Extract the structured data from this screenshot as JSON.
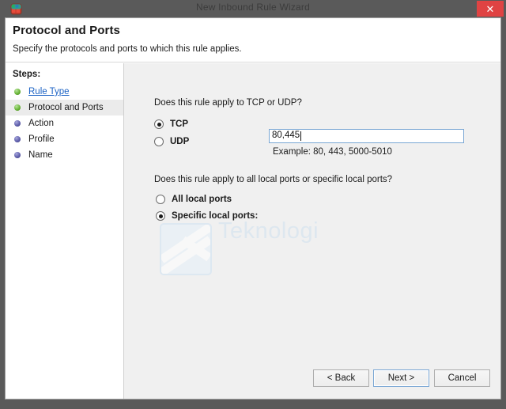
{
  "window": {
    "title": "New Inbound Rule Wizard",
    "icon": "firewall-shield-icon",
    "close_label": "✕"
  },
  "header": {
    "title": "Protocol and Ports",
    "subtitle": "Specify the protocols and ports to which this rule applies."
  },
  "sidebar": {
    "steps_label": "Steps:",
    "items": [
      {
        "label": "Rule Type",
        "state": "done",
        "is_link": true,
        "current": false
      },
      {
        "label": "Protocol and Ports",
        "state": "done",
        "is_link": false,
        "current": true
      },
      {
        "label": "Action",
        "state": "todo",
        "is_link": false,
        "current": false
      },
      {
        "label": "Profile",
        "state": "todo",
        "is_link": false,
        "current": false
      },
      {
        "label": "Name",
        "state": "todo",
        "is_link": false,
        "current": false
      }
    ]
  },
  "content": {
    "question_protocol": "Does this rule apply to TCP or UDP?",
    "protocol_options": [
      {
        "label": "TCP",
        "selected": true
      },
      {
        "label": "UDP",
        "selected": false
      }
    ],
    "question_ports": "Does this rule apply to all local ports or specific local ports?",
    "port_options": [
      {
        "label": "All local ports",
        "selected": false
      },
      {
        "label": "Specific local ports:",
        "selected": true
      }
    ],
    "ports_value": "80,445",
    "ports_example": "Example: 80, 443, 5000-5010",
    "watermark_text": "Teknologi"
  },
  "footer": {
    "back_label": "< Back",
    "next_label": "Next >",
    "cancel_label": "Cancel"
  },
  "colors": {
    "titlebar": "#5a5a5a",
    "close_button": "#e04343",
    "link": "#1b62c4",
    "step_done": "#63b031",
    "step_todo": "#5a5aa8",
    "content_bg": "#f0f0f0",
    "focus_border": "#7aa7d4"
  }
}
